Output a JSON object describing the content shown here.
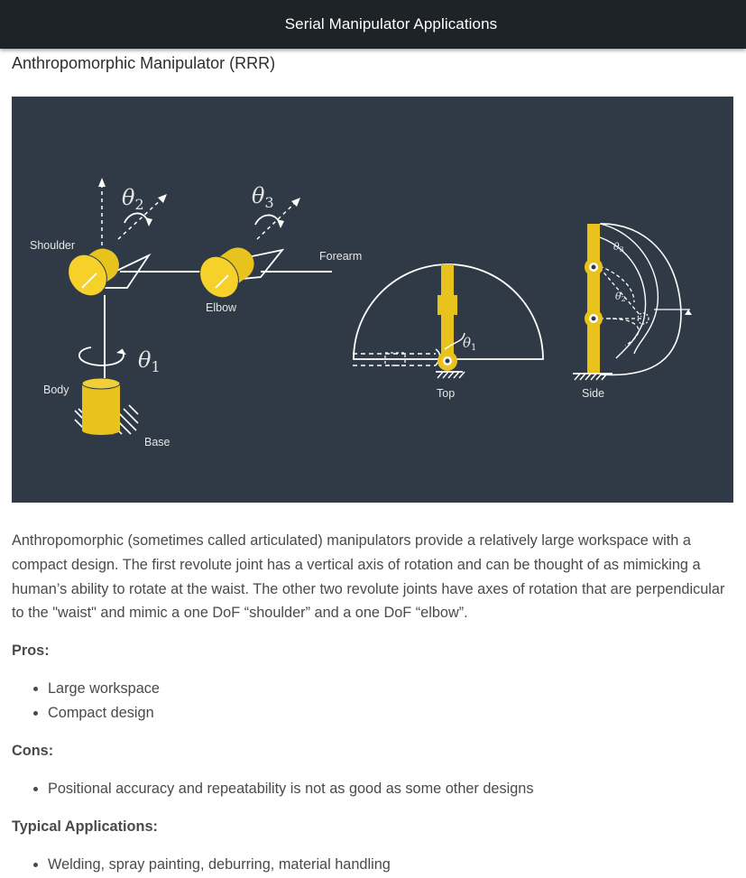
{
  "header": {
    "title": "Serial Manipulator Applications"
  },
  "section": {
    "title": "Anthropomorphic Manipulator (RRR)"
  },
  "figure": {
    "labels": {
      "shoulder": "Shoulder",
      "elbow": "Elbow",
      "forearm": "Forearm",
      "body": "Body",
      "base": "Base",
      "top": "Top",
      "side": "Side"
    },
    "greek": {
      "theta": "θ",
      "sub1": "1",
      "sub2": "2",
      "sub3": "3"
    },
    "colors": {
      "background": "#2f3a46",
      "joint": "#e8c31e",
      "line": "#ffffff"
    }
  },
  "description": "Anthropomorphic (sometimes called articulated) manipulators provide a relatively large workspace with a compact design. The first revolute joint has a vertical axis of rotation and can be thought of as mimicking a human’s ability to rotate at the waist. The other two revolute joints have axes of rotation that are perpendicular to the \"waist\" and mimic a one DoF “shoulder” and a one DoF “elbow”.",
  "pros": {
    "heading": "Pros:",
    "items": [
      "Large workspace",
      "Compact design"
    ]
  },
  "cons": {
    "heading": "Cons:",
    "items": [
      "Positional accuracy and repeatability is not as good as some other designs"
    ]
  },
  "applications": {
    "heading": "Typical Applications:",
    "items": [
      "Welding, spray painting, deburring, material handling"
    ]
  }
}
